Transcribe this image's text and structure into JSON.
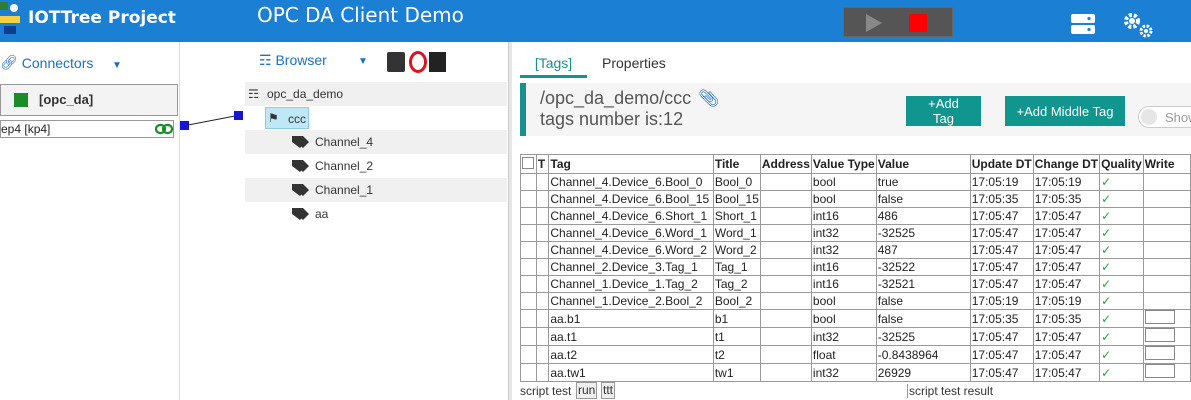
{
  "header": {
    "app_title": "IOTTree Project",
    "page_title": "OPC DA Client Demo",
    "colors": {
      "bar": "#1b7fd4",
      "stop": "#ff0000"
    }
  },
  "left": {
    "connectors_label": "Connectors",
    "connector_name": "[opc_da]",
    "connector_sub": "ep4 [kp4]"
  },
  "browser": {
    "label": "Browser",
    "root": "opc_da_demo",
    "selected": "ccc",
    "children": [
      "Channel_4",
      "Channel_2",
      "Channel_1",
      "aa"
    ]
  },
  "right": {
    "tabs": [
      "[Tags]",
      "Properties"
    ],
    "path": "/opc_da_demo/ccc",
    "tag_count": "tags number is:12",
    "add_tag": "+Add Tag",
    "add_middle_tag": "+Add Middle Tag",
    "show_label": "Show"
  },
  "table": {
    "headers": [
      "",
      "T",
      "Tag",
      "Title",
      "Address",
      "Value Type",
      "Value",
      "Update DT",
      "Change DT",
      "Quality",
      "Write"
    ],
    "rows": [
      [
        "Channel_4.Device_6.Bool_0",
        "Bool_0",
        "",
        "bool",
        "true",
        "17:05:19",
        "17:05:19"
      ],
      [
        "Channel_4.Device_6.Bool_15",
        "Bool_15",
        "",
        "bool",
        "false",
        "17:05:35",
        "17:05:35"
      ],
      [
        "Channel_4.Device_6.Short_1",
        "Short_1",
        "",
        "int16",
        "486",
        "17:05:47",
        "17:05:47"
      ],
      [
        "Channel_4.Device_6.Word_1",
        "Word_1",
        "",
        "int32",
        "-32525",
        "17:05:47",
        "17:05:47"
      ],
      [
        "Channel_4.Device_6.Word_2",
        "Word_2",
        "",
        "int32",
        "487",
        "17:05:47",
        "17:05:47"
      ],
      [
        "Channel_2.Device_3.Tag_1",
        "Tag_1",
        "",
        "int16",
        "-32522",
        "17:05:47",
        "17:05:47"
      ],
      [
        "Channel_1.Device_1.Tag_2",
        "Tag_2",
        "",
        "int16",
        "-32521",
        "17:05:47",
        "17:05:47"
      ],
      [
        "Channel_1.Device_2.Bool_2",
        "Bool_2",
        "",
        "bool",
        "false",
        "17:05:19",
        "17:05:19"
      ],
      [
        "aa.b1",
        "b1",
        "",
        "bool",
        "false",
        "17:05:35",
        "17:05:35"
      ],
      [
        "aa.t1",
        "t1",
        "",
        "int32",
        "-32525",
        "17:05:47",
        "17:05:47"
      ],
      [
        "aa.t2",
        "t2",
        "",
        "float",
        "-0.8438964",
        "17:05:47",
        "17:05:47"
      ],
      [
        "aa.tw1",
        "tw1",
        "",
        "int32",
        "26929",
        "17:05:47",
        "17:05:47"
      ]
    ],
    "write_box_rows": [
      8,
      9,
      10,
      11
    ]
  },
  "script": {
    "label": "script test",
    "run": "run",
    "ttt": "ttt",
    "result": "script test result"
  }
}
